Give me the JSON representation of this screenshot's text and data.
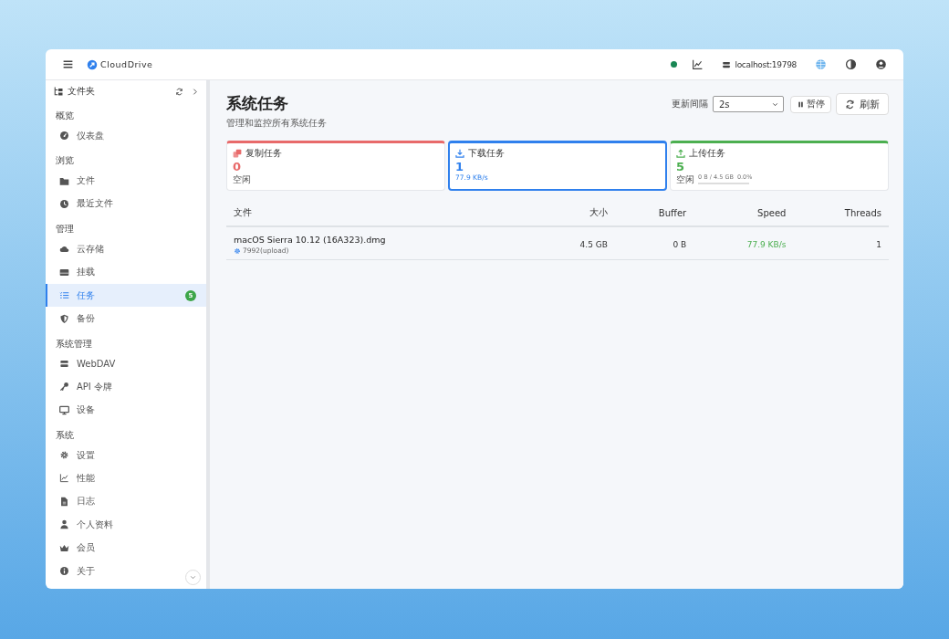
{
  "app": {
    "brand": "CloudDrive",
    "server": "localhost:19798"
  },
  "sidebar": {
    "header": "文件夹",
    "sections": [
      {
        "title": "概览",
        "items": [
          {
            "label": "仪表盘",
            "selected": false
          }
        ]
      },
      {
        "title": "浏览",
        "items": [
          {
            "label": "文件",
            "selected": false
          },
          {
            "label": "最近文件",
            "selected": false
          }
        ]
      },
      {
        "title": "管理",
        "items": [
          {
            "label": "云存储",
            "selected": false
          },
          {
            "label": "挂载",
            "selected": false
          },
          {
            "label": "任务",
            "selected": true,
            "badge": "5"
          },
          {
            "label": "备份",
            "selected": false
          }
        ]
      },
      {
        "title": "系统管理",
        "items": [
          {
            "label": "WebDAV",
            "selected": false
          },
          {
            "label": "API 令牌",
            "selected": false
          },
          {
            "label": "设备",
            "selected": false
          }
        ]
      },
      {
        "title": "系统",
        "items": [
          {
            "label": "设置",
            "selected": false
          },
          {
            "label": "性能",
            "selected": false
          },
          {
            "label": "日志",
            "selected": false
          },
          {
            "label": "个人资料",
            "selected": false
          },
          {
            "label": "会员",
            "selected": false
          },
          {
            "label": "关于",
            "selected": false
          }
        ]
      }
    ]
  },
  "page": {
    "title": "系统任务",
    "subtitle": "管理和监控所有系统任务",
    "interval_label": "更新间隔",
    "interval": "2s",
    "pause": "暂停",
    "refresh": "刷新"
  },
  "cards": [
    {
      "title": "复制任务",
      "count": "0",
      "status": "空闲",
      "color": "#e86a6a",
      "selected": false
    },
    {
      "title": "下载任务",
      "count": "1",
      "speed": "77.9 KB/s",
      "color": "#2f80ed",
      "selected": true
    },
    {
      "title": "上传任务",
      "count": "5",
      "status": "空闲",
      "progress_text": "0 B / 4.5 GB",
      "percent": "0.0%",
      "level": 0,
      "color": "#4caf50",
      "selected": false
    }
  ],
  "table": {
    "columns": [
      "文件",
      "大小",
      "Buffer",
      "Speed",
      "Threads"
    ],
    "rows": [
      {
        "name": "macOS Sierra 10.12 (16A323).dmg",
        "detail": "7992(upload)",
        "size": "4.5 GB",
        "buffer": "0 B",
        "speed": "77.9 KB/s",
        "threads": "1"
      }
    ]
  }
}
